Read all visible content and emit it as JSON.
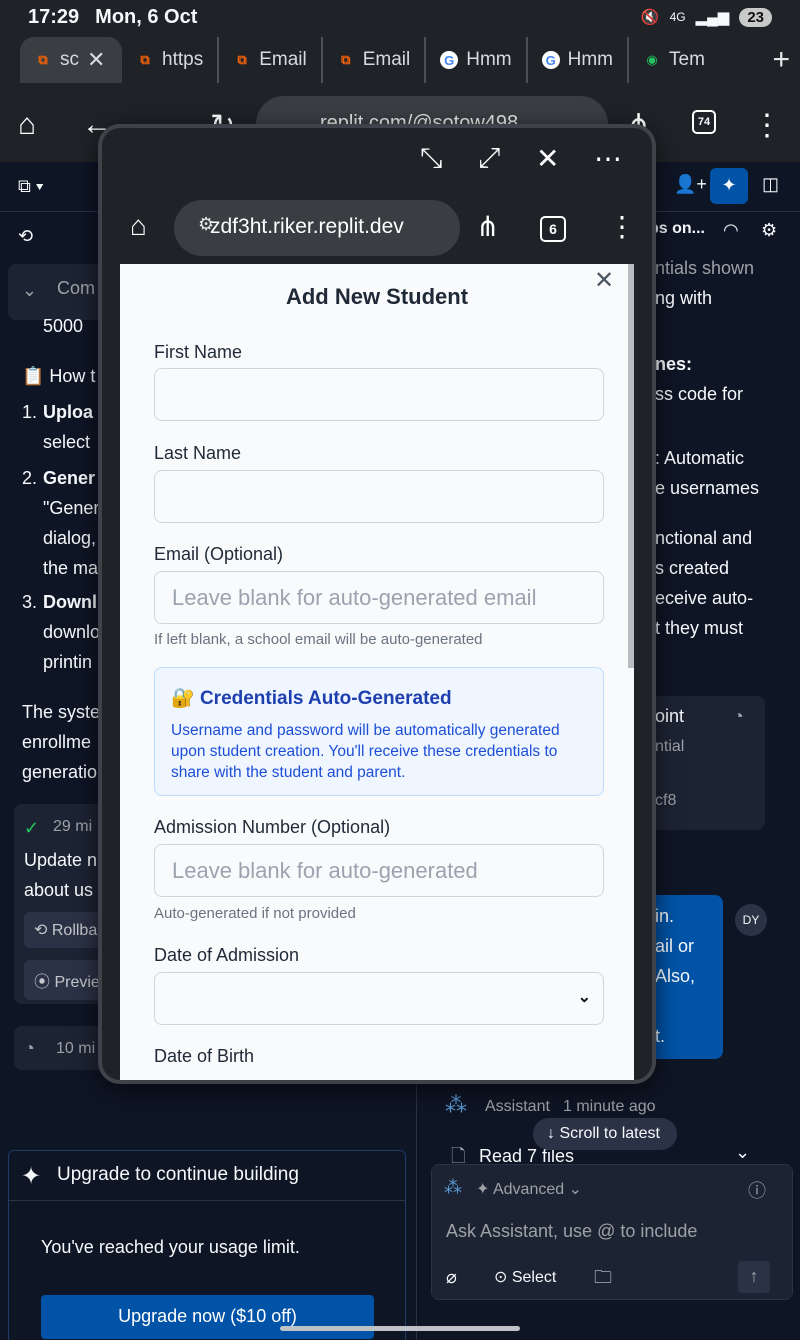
{
  "status_bar": {
    "time": "17:29",
    "date": "Mon, 6 Oct",
    "network": "4G",
    "battery": "23"
  },
  "browser_tabs": [
    {
      "label": "sc",
      "icon": "replit",
      "active": true
    },
    {
      "label": "https",
      "icon": "replit"
    },
    {
      "label": "Email",
      "icon": "replit"
    },
    {
      "label": "Email",
      "icon": "replit"
    },
    {
      "label": "Hmm",
      "icon": "google"
    },
    {
      "label": "Hmm",
      "icon": "google"
    },
    {
      "label": "Tem",
      "icon": "other"
    }
  ],
  "main_toolbar": {
    "url": "replit.com/@sotow498",
    "tab_count": "74"
  },
  "popup": {
    "url": "zdf3ht.riker.replit.dev",
    "tab_count": "6",
    "form": {
      "title": "Add New Student",
      "first_name_label": "First Name",
      "first_name_value": "",
      "last_name_label": "Last Name",
      "last_name_value": "",
      "email_label": "Email (Optional)",
      "email_placeholder": "Leave blank for auto-generated email",
      "email_help": "If left blank, a school email will be auto-generated",
      "credentials_title": "Credentials Auto-Generated",
      "credentials_body": "Username and password will be automatically generated upon student creation. You'll receive these credentials to share with the student and parent.",
      "admission_label": "Admission Number (Optional)",
      "admission_placeholder": "Leave blank for auto-generated",
      "admission_help": "Auto-generated if not provided",
      "date_admission_label": "Date of Admission",
      "date_admission_value": "",
      "dob_label": "Date of Birth"
    }
  },
  "left_pane": {
    "comp_label": "Com",
    "comp_value": "5000",
    "how_heading": "How t",
    "steps": [
      {
        "num": "1.",
        "bold": "Uploa",
        "rest": [
          "select"
        ]
      },
      {
        "num": "2.",
        "bold": "Gener",
        "rest": [
          "\"Gener",
          "dialog,",
          "the ma"
        ]
      },
      {
        "num": "3.",
        "bold": "Downl",
        "rest": [
          "downlo",
          "printin"
        ]
      }
    ],
    "paragraph": [
      "The syste",
      "enrollme",
      "generatio"
    ],
    "checkpoint_time": "29 mi",
    "checkpoint_text": [
      "Update n",
      "about us"
    ],
    "rollback_label": "Rollba",
    "preview_label": "Previe",
    "time2": "10 mi",
    "upgrade": {
      "title": "Upgrade to continue building",
      "message": "You've reached your usage limit.",
      "button": "Upgrade now ($10 off)"
    }
  },
  "right_pane": {
    "header_text": "ps on...",
    "lines": [
      "ntials shown",
      "ng with",
      "nes:",
      "ss code for",
      ": Automatic",
      "e usernames",
      "nctional and",
      "s created",
      "eceive auto-",
      "t they must"
    ],
    "card_lines": [
      "oint",
      "ntial",
      "cf8"
    ],
    "user_lines": [
      "in.",
      "ail or",
      "Also,",
      "t."
    ],
    "user_avatar": "DY",
    "assistant_label": "Assistant",
    "assistant_time": "1 minute ago",
    "scroll_latest": "Scroll to latest",
    "read_files": "Read 7 files",
    "mode_label": "Advanced",
    "input_placeholder": "Ask Assistant, use @ to include",
    "select_label": "Select"
  }
}
